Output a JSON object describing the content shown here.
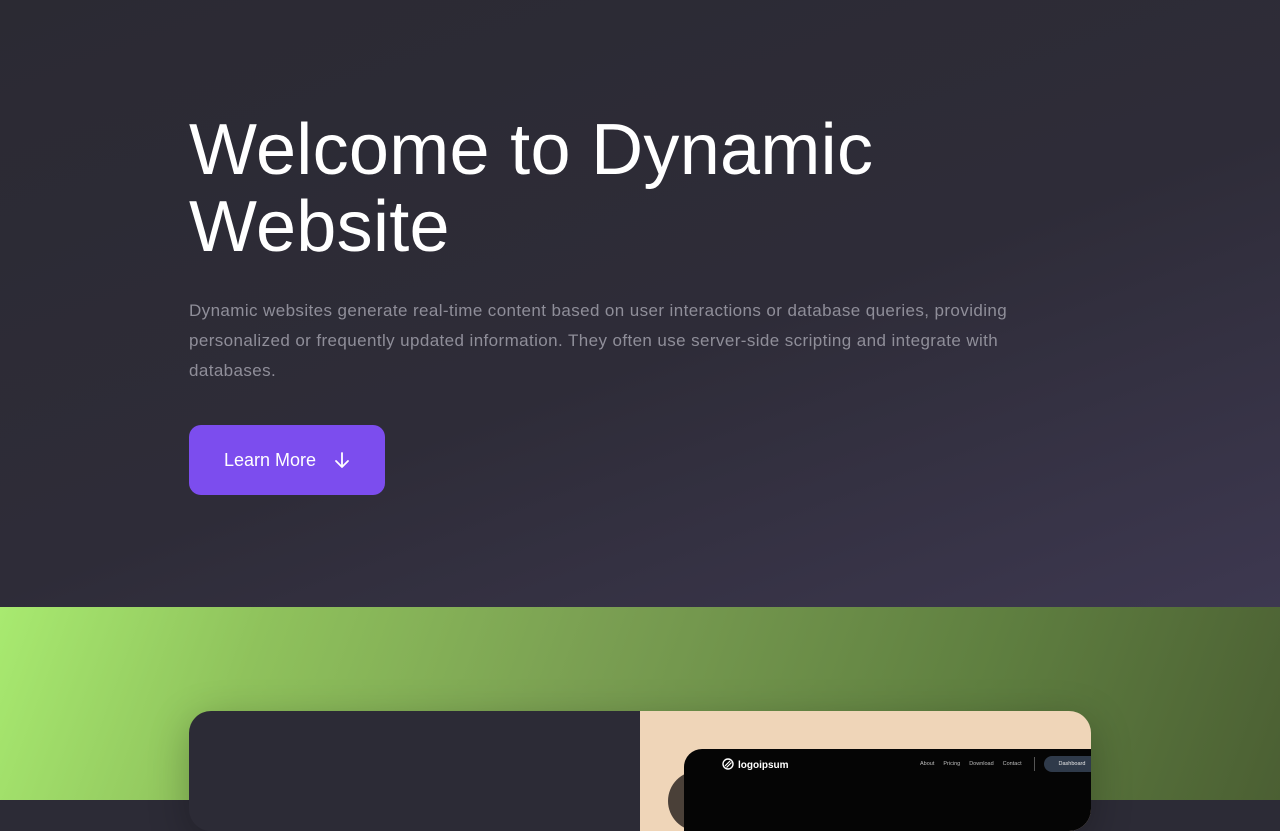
{
  "hero": {
    "title_line1": "Welcome to Dynamic",
    "title_line2": "Website",
    "description": "Dynamic websites generate real-time content based on user interactions or database queries, providing personalized or frequently updated information. They often use server-side scripting and integrate with databases.",
    "cta_label": "Learn More",
    "cta_icon": "arrow-down-icon"
  },
  "preview": {
    "logo_text": "logoipsum",
    "nav": [
      "About",
      "Pricing",
      "Download",
      "Contact"
    ],
    "nav_button": "Dashboard"
  },
  "colors": {
    "hero_bg": "#2c2b36",
    "accent": "#7c4dee",
    "green_start": "#a8ea70",
    "green_end": "#4b5f33",
    "preview_bg": "#efd5b8"
  }
}
